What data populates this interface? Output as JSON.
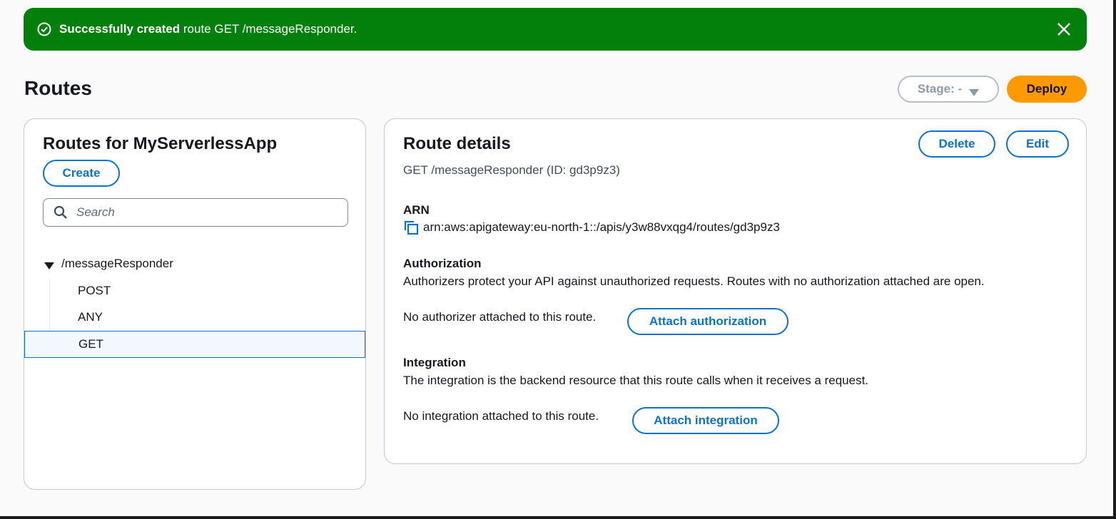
{
  "flash": {
    "bold": "Successfully created",
    "text": " route GET /messageResponder."
  },
  "header": {
    "title": "Routes",
    "stage_label": "Stage: -",
    "deploy_label": "Deploy"
  },
  "routes_panel": {
    "title": "Routes for MyServerlessApp",
    "create_label": "Create",
    "search_placeholder": "Search",
    "tree": {
      "root": "/messageResponder",
      "methods": [
        "POST",
        "ANY",
        "GET"
      ],
      "selected": "GET"
    }
  },
  "details": {
    "title": "Route details",
    "delete_label": "Delete",
    "edit_label": "Edit",
    "subtitle": "GET /messageResponder (ID: gd3p9z3)",
    "arn_heading": "ARN",
    "arn_value": "arn:aws:apigateway:eu-north-1::/apis/y3w88vxqg4/routes/gd3p9z3",
    "authorization": {
      "heading": "Authorization",
      "description": "Authorizers protect your API against unauthorized requests. Routes with no authorization attached are open.",
      "status": "No authorizer attached to this route.",
      "button": "Attach authorization"
    },
    "integration": {
      "heading": "Integration",
      "description": "The integration is the backend resource that this route calls when it receives a request.",
      "status": "No integration attached to this route.",
      "button": "Attach integration"
    }
  },
  "colors": {
    "success": "#037f0c",
    "primary": "#0972d3",
    "deploy": "#ff9900"
  }
}
